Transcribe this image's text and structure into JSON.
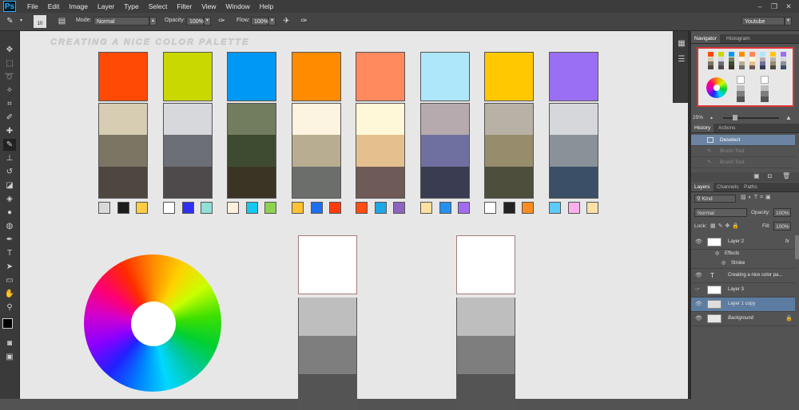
{
  "app": {
    "logo": "Ps"
  },
  "menu": [
    "File",
    "Edit",
    "Image",
    "Layer",
    "Type",
    "Select",
    "Filter",
    "View",
    "Window",
    "Help"
  ],
  "window_controls": [
    "–",
    "❐",
    "✕"
  ],
  "options_bar": {
    "brush_size": "10",
    "mode_label": "Mode:",
    "mode_value": "Normal",
    "opacity_label": "Opacity:",
    "opacity_value": "100%",
    "flow_label": "Flow:",
    "flow_value": "100%",
    "workspace": "Youtube"
  },
  "canvas": {
    "title": "CREATING A NICE COLOR PALETTE",
    "top_swatches": [
      "#ff4a06",
      "#c8d800",
      "#0098f5",
      "#ff8c00",
      "#ff8a5e",
      "#aee6fa",
      "#ffc800",
      "#9b6ff3"
    ],
    "shade_stacks": [
      [
        "#d6cdb3",
        "#7b7564",
        "#4e4740"
      ],
      [
        "#d6d8dc",
        "#6d6f76",
        "#4e4a4b"
      ],
      [
        "#717d5e",
        "#3f4b30",
        "#3b3425"
      ],
      [
        "#fcf3e1",
        "#b8ad90",
        "#6c6e6c"
      ],
      [
        "#fff8d8",
        "#e5c08f",
        "#6e5a57"
      ],
      [
        "#b6aaae",
        "#7070a0",
        "#3a3d51"
      ],
      [
        "#b8b2a6",
        "#978c6c",
        "#4d4e3c"
      ],
      [
        "#d5d7db",
        "#8a9198",
        "#3b4f66"
      ]
    ],
    "mini_swatches": [
      [
        "#d9d9d9",
        "#1c1c1c",
        "#ffcc44"
      ],
      [
        "#ffffff",
        "#2f2ff5",
        "#8fe0d6"
      ],
      [
        "#fff0dc",
        "#15c8f0",
        "#8ed34f"
      ],
      [
        "#ffc233",
        "#1e6ff0",
        "#ff3c0a"
      ],
      [
        "#ff4d14",
        "#1ea7e6",
        "#8e64c0"
      ],
      [
        "#ffe0a0",
        "#2590f0",
        "#a26bf0"
      ],
      [
        "#ffffff",
        "#222222",
        "#ff8c22"
      ],
      [
        "#5ecbff",
        "#ffb0ea",
        "#ffe1a8"
      ]
    ],
    "gray_stacks": [
      [
        "#ffffff",
        "#bebebe",
        "#7e7e7e",
        "#545454"
      ],
      [
        "#ffffff",
        "#bebebe",
        "#7e7e7e",
        "#545454"
      ]
    ]
  },
  "navigator": {
    "tabs": [
      "Navigator",
      "Histogram"
    ],
    "zoom": "25%"
  },
  "history": {
    "tabs": [
      "History",
      "Actions"
    ],
    "items": [
      "Deselect",
      "Brush Tool",
      "Brush Tool"
    ]
  },
  "layers": {
    "tabs": [
      "Layers",
      "Channels",
      "Paths"
    ],
    "filter": "Kind",
    "blend_mode": "Normal",
    "opacity_label": "Opacity:",
    "opacity_value": "100%",
    "lock_label": "Lock:",
    "fill_label": "Fill:",
    "fill_value": "100%",
    "rows": [
      "Layer 2",
      "Effects",
      "Stroke",
      "Creating a nice color pa...",
      "Layer 3",
      "Layer 1 copy",
      "Background"
    ],
    "fx": "fx"
  }
}
